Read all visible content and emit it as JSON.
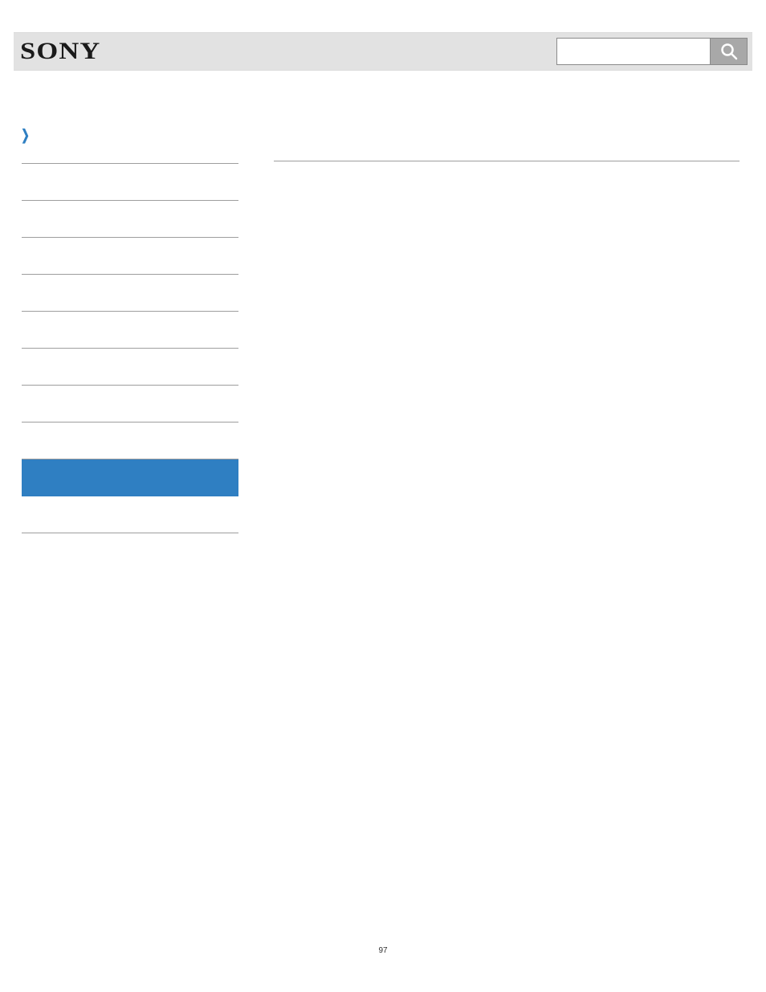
{
  "header": {
    "logo_text": "SONY",
    "search": {
      "value": "",
      "placeholder": ""
    }
  },
  "sidebar": {
    "items": [
      {
        "label": "",
        "selected": false
      },
      {
        "label": "",
        "selected": false
      },
      {
        "label": "",
        "selected": false
      },
      {
        "label": "",
        "selected": false
      },
      {
        "label": "",
        "selected": false
      },
      {
        "label": "",
        "selected": false
      },
      {
        "label": "",
        "selected": false
      },
      {
        "label": "",
        "selected": false
      },
      {
        "label": "",
        "selected": false
      },
      {
        "label": "",
        "selected": true
      },
      {
        "label": "",
        "selected": false
      }
    ]
  },
  "page_number": "97"
}
